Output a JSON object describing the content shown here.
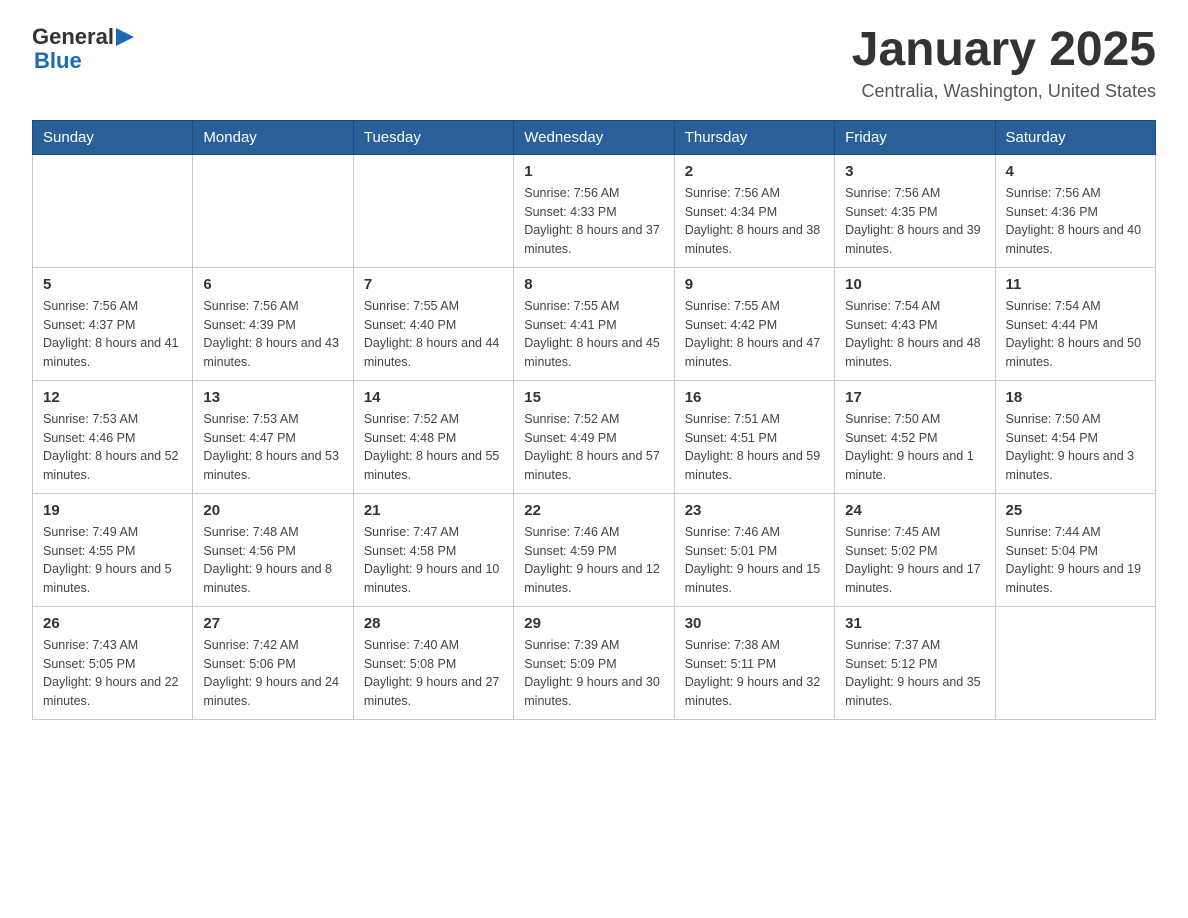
{
  "header": {
    "logo": {
      "general": "General",
      "blue": "Blue"
    },
    "title": "January 2025",
    "location": "Centralia, Washington, United States"
  },
  "days_of_week": [
    "Sunday",
    "Monday",
    "Tuesday",
    "Wednesday",
    "Thursday",
    "Friday",
    "Saturday"
  ],
  "weeks": [
    [
      {
        "day": "",
        "sunrise": "",
        "sunset": "",
        "daylight": ""
      },
      {
        "day": "",
        "sunrise": "",
        "sunset": "",
        "daylight": ""
      },
      {
        "day": "",
        "sunrise": "",
        "sunset": "",
        "daylight": ""
      },
      {
        "day": "1",
        "sunrise": "Sunrise: 7:56 AM",
        "sunset": "Sunset: 4:33 PM",
        "daylight": "Daylight: 8 hours and 37 minutes."
      },
      {
        "day": "2",
        "sunrise": "Sunrise: 7:56 AM",
        "sunset": "Sunset: 4:34 PM",
        "daylight": "Daylight: 8 hours and 38 minutes."
      },
      {
        "day": "3",
        "sunrise": "Sunrise: 7:56 AM",
        "sunset": "Sunset: 4:35 PM",
        "daylight": "Daylight: 8 hours and 39 minutes."
      },
      {
        "day": "4",
        "sunrise": "Sunrise: 7:56 AM",
        "sunset": "Sunset: 4:36 PM",
        "daylight": "Daylight: 8 hours and 40 minutes."
      }
    ],
    [
      {
        "day": "5",
        "sunrise": "Sunrise: 7:56 AM",
        "sunset": "Sunset: 4:37 PM",
        "daylight": "Daylight: 8 hours and 41 minutes."
      },
      {
        "day": "6",
        "sunrise": "Sunrise: 7:56 AM",
        "sunset": "Sunset: 4:39 PM",
        "daylight": "Daylight: 8 hours and 43 minutes."
      },
      {
        "day": "7",
        "sunrise": "Sunrise: 7:55 AM",
        "sunset": "Sunset: 4:40 PM",
        "daylight": "Daylight: 8 hours and 44 minutes."
      },
      {
        "day": "8",
        "sunrise": "Sunrise: 7:55 AM",
        "sunset": "Sunset: 4:41 PM",
        "daylight": "Daylight: 8 hours and 45 minutes."
      },
      {
        "day": "9",
        "sunrise": "Sunrise: 7:55 AM",
        "sunset": "Sunset: 4:42 PM",
        "daylight": "Daylight: 8 hours and 47 minutes."
      },
      {
        "day": "10",
        "sunrise": "Sunrise: 7:54 AM",
        "sunset": "Sunset: 4:43 PM",
        "daylight": "Daylight: 8 hours and 48 minutes."
      },
      {
        "day": "11",
        "sunrise": "Sunrise: 7:54 AM",
        "sunset": "Sunset: 4:44 PM",
        "daylight": "Daylight: 8 hours and 50 minutes."
      }
    ],
    [
      {
        "day": "12",
        "sunrise": "Sunrise: 7:53 AM",
        "sunset": "Sunset: 4:46 PM",
        "daylight": "Daylight: 8 hours and 52 minutes."
      },
      {
        "day": "13",
        "sunrise": "Sunrise: 7:53 AM",
        "sunset": "Sunset: 4:47 PM",
        "daylight": "Daylight: 8 hours and 53 minutes."
      },
      {
        "day": "14",
        "sunrise": "Sunrise: 7:52 AM",
        "sunset": "Sunset: 4:48 PM",
        "daylight": "Daylight: 8 hours and 55 minutes."
      },
      {
        "day": "15",
        "sunrise": "Sunrise: 7:52 AM",
        "sunset": "Sunset: 4:49 PM",
        "daylight": "Daylight: 8 hours and 57 minutes."
      },
      {
        "day": "16",
        "sunrise": "Sunrise: 7:51 AM",
        "sunset": "Sunset: 4:51 PM",
        "daylight": "Daylight: 8 hours and 59 minutes."
      },
      {
        "day": "17",
        "sunrise": "Sunrise: 7:50 AM",
        "sunset": "Sunset: 4:52 PM",
        "daylight": "Daylight: 9 hours and 1 minute."
      },
      {
        "day": "18",
        "sunrise": "Sunrise: 7:50 AM",
        "sunset": "Sunset: 4:54 PM",
        "daylight": "Daylight: 9 hours and 3 minutes."
      }
    ],
    [
      {
        "day": "19",
        "sunrise": "Sunrise: 7:49 AM",
        "sunset": "Sunset: 4:55 PM",
        "daylight": "Daylight: 9 hours and 5 minutes."
      },
      {
        "day": "20",
        "sunrise": "Sunrise: 7:48 AM",
        "sunset": "Sunset: 4:56 PM",
        "daylight": "Daylight: 9 hours and 8 minutes."
      },
      {
        "day": "21",
        "sunrise": "Sunrise: 7:47 AM",
        "sunset": "Sunset: 4:58 PM",
        "daylight": "Daylight: 9 hours and 10 minutes."
      },
      {
        "day": "22",
        "sunrise": "Sunrise: 7:46 AM",
        "sunset": "Sunset: 4:59 PM",
        "daylight": "Daylight: 9 hours and 12 minutes."
      },
      {
        "day": "23",
        "sunrise": "Sunrise: 7:46 AM",
        "sunset": "Sunset: 5:01 PM",
        "daylight": "Daylight: 9 hours and 15 minutes."
      },
      {
        "day": "24",
        "sunrise": "Sunrise: 7:45 AM",
        "sunset": "Sunset: 5:02 PM",
        "daylight": "Daylight: 9 hours and 17 minutes."
      },
      {
        "day": "25",
        "sunrise": "Sunrise: 7:44 AM",
        "sunset": "Sunset: 5:04 PM",
        "daylight": "Daylight: 9 hours and 19 minutes."
      }
    ],
    [
      {
        "day": "26",
        "sunrise": "Sunrise: 7:43 AM",
        "sunset": "Sunset: 5:05 PM",
        "daylight": "Daylight: 9 hours and 22 minutes."
      },
      {
        "day": "27",
        "sunrise": "Sunrise: 7:42 AM",
        "sunset": "Sunset: 5:06 PM",
        "daylight": "Daylight: 9 hours and 24 minutes."
      },
      {
        "day": "28",
        "sunrise": "Sunrise: 7:40 AM",
        "sunset": "Sunset: 5:08 PM",
        "daylight": "Daylight: 9 hours and 27 minutes."
      },
      {
        "day": "29",
        "sunrise": "Sunrise: 7:39 AM",
        "sunset": "Sunset: 5:09 PM",
        "daylight": "Daylight: 9 hours and 30 minutes."
      },
      {
        "day": "30",
        "sunrise": "Sunrise: 7:38 AM",
        "sunset": "Sunset: 5:11 PM",
        "daylight": "Daylight: 9 hours and 32 minutes."
      },
      {
        "day": "31",
        "sunrise": "Sunrise: 7:37 AM",
        "sunset": "Sunset: 5:12 PM",
        "daylight": "Daylight: 9 hours and 35 minutes."
      },
      {
        "day": "",
        "sunrise": "",
        "sunset": "",
        "daylight": ""
      }
    ]
  ]
}
